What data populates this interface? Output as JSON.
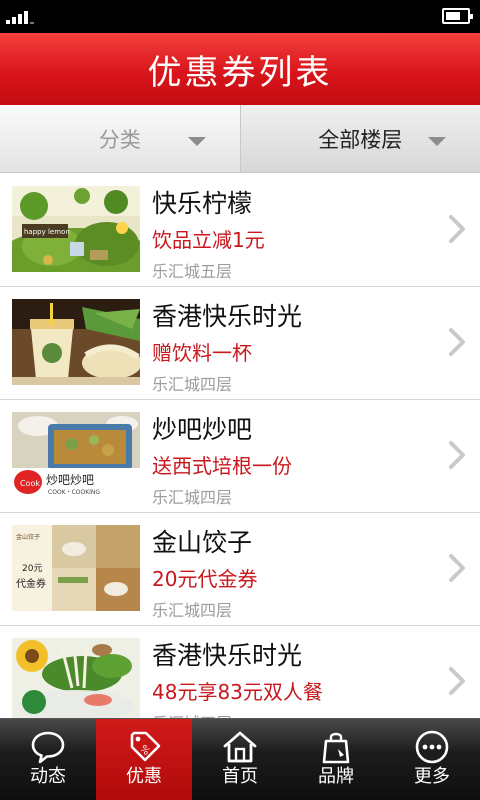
{
  "header": {
    "title": "优惠券列表"
  },
  "filters": [
    {
      "label": "分类",
      "state": "inactive"
    },
    {
      "label": "全部楼层",
      "state": "selected"
    }
  ],
  "coupons": [
    {
      "name": "快乐柠檬",
      "offer": "饮品立减1元",
      "location": "乐汇城五层",
      "image": "happy-lemon-drink-shop-photo"
    },
    {
      "name": "香港快乐时光",
      "offer": "赠饮料一杯",
      "location": "乐汇城四层",
      "image": "drink-and-noodles-photo"
    },
    {
      "name": "炒吧炒吧",
      "offer": "送西式培根一份",
      "location": "乐汇城四层",
      "image": "cook-cooking-food-photo"
    },
    {
      "name": "金山饺子",
      "offer": "20元代金券",
      "location": "乐汇城四层",
      "image": "dumplings-20-yuan-voucher-photo"
    },
    {
      "name": "香港快乐时光",
      "offer": "48元享83元双人餐",
      "location": "乐汇城四层",
      "image": "vegetables-platter-photo"
    }
  ],
  "coupon3_image_text": {
    "brand": "炒吧炒吧",
    "sub": "COOK・COOKING",
    "badge": "Cook"
  },
  "coupon4_image_text": {
    "price": "20元",
    "word": "代金券",
    "logo": "金山饺子"
  },
  "tabs": [
    {
      "label": "动态",
      "icon": "chat-bubble-icon",
      "active": false
    },
    {
      "label": "优惠",
      "icon": "coupon-tag-icon",
      "active": true
    },
    {
      "label": "首页",
      "icon": "home-icon",
      "active": false
    },
    {
      "label": "品牌",
      "icon": "shopping-bag-icon",
      "active": false
    },
    {
      "label": "更多",
      "icon": "more-dots-icon",
      "active": false
    }
  ],
  "colors": {
    "title_bar": "#d9151b",
    "offer_text": "#c8171d",
    "tab_active": "#c01010",
    "tab_bar": "#1d1d1d"
  }
}
